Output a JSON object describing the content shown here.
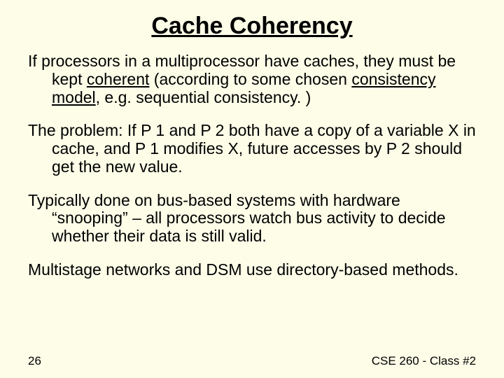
{
  "title": "Cache Coherency",
  "p1": {
    "a": "If processors in a multiprocessor have caches, they must be kept ",
    "coherent": "coherent",
    "b": " (according to some chosen ",
    "model": "consistency model",
    "c": ", e.g. sequential consistency. )"
  },
  "p2": "The problem: If P 1 and P 2 both have a copy of a variable X in cache, and P 1 modifies X, future accesses by P 2 should get the new value.",
  "p3": "Typically done on bus-based systems with hardware “snooping” – all processors watch bus activity to decide whether their data is still valid.",
  "p4": "Multistage networks and DSM use directory-based methods.",
  "footer": {
    "page": "26",
    "course": "CSE 260 - Class #2"
  }
}
